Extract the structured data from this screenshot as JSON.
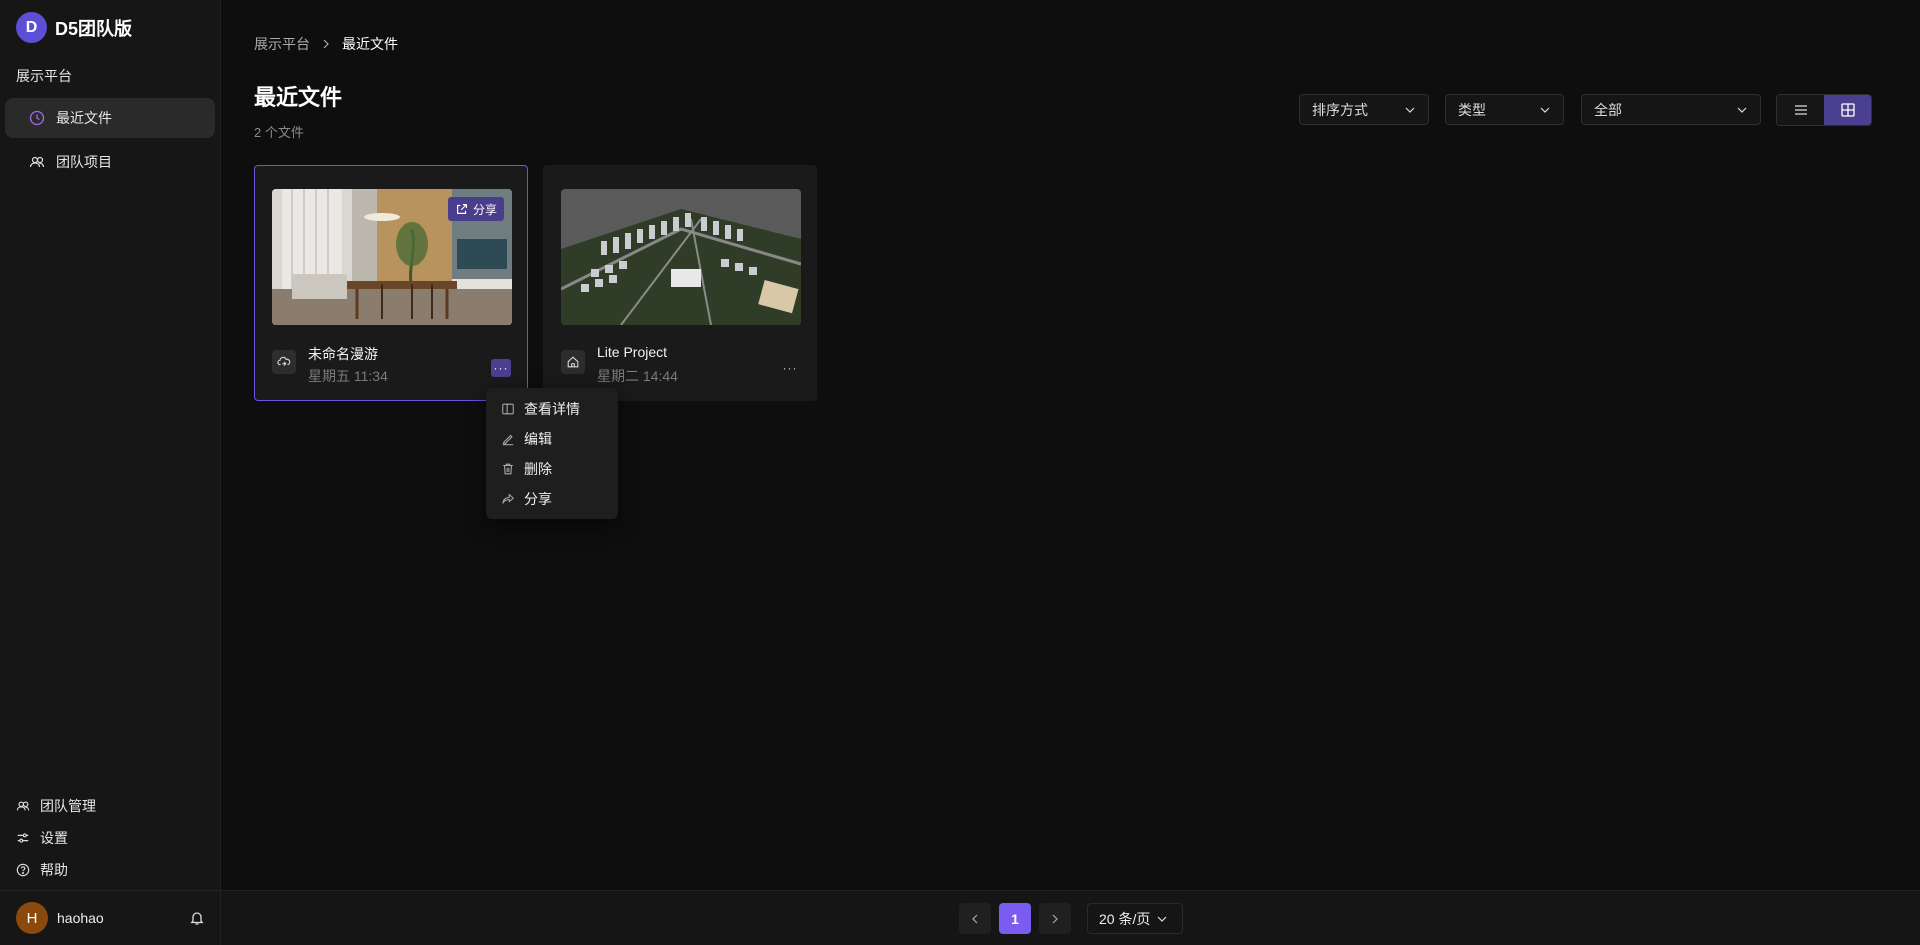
{
  "brand": {
    "logo_letter": "D",
    "name": "D5团队版"
  },
  "sidebar": {
    "section_title": "展示平台",
    "items": [
      {
        "label": "最近文件",
        "icon": "clock-icon",
        "active": true
      },
      {
        "label": "团队项目",
        "icon": "team-icon",
        "active": false
      }
    ],
    "bottom_links": [
      {
        "label": "团队管理",
        "icon": "team-icon"
      },
      {
        "label": "设置",
        "icon": "sliders-icon"
      },
      {
        "label": "帮助",
        "icon": "help-icon"
      }
    ],
    "user": {
      "avatar_letter": "H",
      "name": "haohao"
    }
  },
  "breadcrumb": [
    "展示平台",
    "最近文件"
  ],
  "page": {
    "title": "最近文件",
    "count_text": "2 个文件"
  },
  "filters": {
    "sort_label": "排序方式",
    "type_label": "类型",
    "scope_value": "全部"
  },
  "view_mode": "grid",
  "cards": [
    {
      "name": "未命名漫游",
      "time": "星期五 11:34",
      "share_label": "分享",
      "icon": "cloud-sync-icon",
      "selected": true,
      "more_label": "···"
    },
    {
      "name": "Lite Project",
      "time": "星期二 14:44",
      "icon": "home-icon",
      "selected": false,
      "more_label": "···"
    }
  ],
  "context_menu": [
    {
      "label": "查看详情",
      "icon": "details-icon"
    },
    {
      "label": "编辑",
      "icon": "edit-icon"
    },
    {
      "label": "删除",
      "icon": "trash-icon"
    },
    {
      "label": "分享",
      "icon": "share-icon"
    }
  ],
  "pagination": {
    "current_page": "1",
    "page_size": "20 条/页"
  },
  "colors": {
    "accent": "#7b5cf0",
    "accent_dark": "#4b3f8f",
    "background": "#0e0e0e"
  }
}
